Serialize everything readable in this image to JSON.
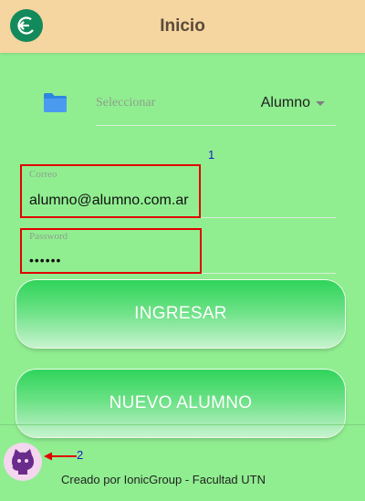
{
  "header": {
    "title": "Inicio",
    "logout_icon": "logout-icon",
    "bg_color": "#f5d5a0",
    "logout_color": "#138a5b"
  },
  "profile_select": {
    "icon": "folder-icon",
    "placeholder": "Seleccionar",
    "value": "Alumno"
  },
  "markers": [
    "1",
    "2"
  ],
  "form": {
    "email": {
      "label": "Correo",
      "value": "alumno@alumno.com.ar"
    },
    "password": {
      "label": "Password",
      "value": "••••••"
    }
  },
  "buttons": {
    "login": "INGRESAR",
    "new_student": "NUEVO ALUMNO"
  },
  "footer": {
    "avatar_icon": "github-icon",
    "credit": "Creado por IonicGroup - Facultad UTN"
  },
  "colors": {
    "background": "#90ee90",
    "highlight_box": "#e00000",
    "button_green": "#2fd45a"
  }
}
